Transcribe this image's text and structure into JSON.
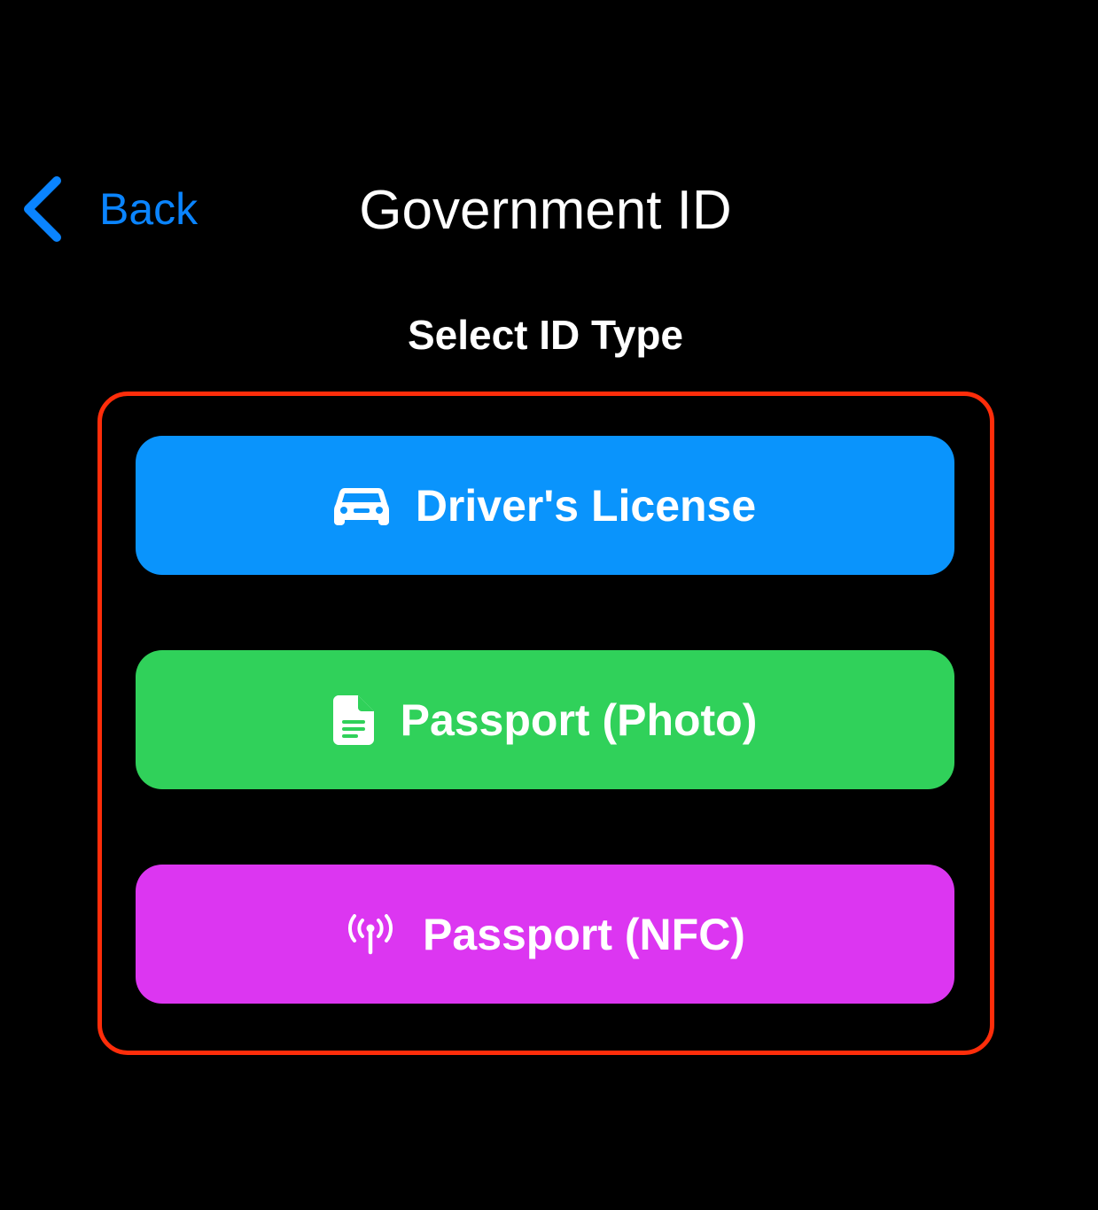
{
  "nav": {
    "back_label": "Back",
    "back_icon": "chevron-left-icon",
    "title": "Government ID"
  },
  "section": {
    "title": "Select ID Type"
  },
  "options": [
    {
      "label": "Driver's License",
      "icon": "car-icon",
      "color": "#0a94fc"
    },
    {
      "label": "Passport (Photo)",
      "icon": "document-icon",
      "color": "#30d15a"
    },
    {
      "label": "Passport (NFC)",
      "icon": "antenna-icon",
      "color": "#dc36f1"
    }
  ],
  "colors": {
    "background": "#000000",
    "accent": "#0a84ff",
    "highlight_frame": "#ff2d0a",
    "text": "#ffffff"
  }
}
